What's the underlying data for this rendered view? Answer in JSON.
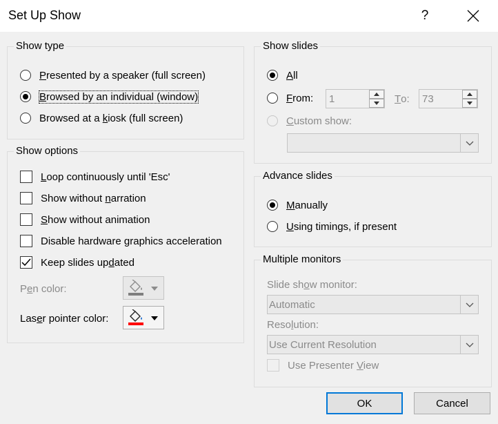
{
  "window": {
    "title": "Set Up Show",
    "help_label": "?"
  },
  "show_type": {
    "legend": "Show type",
    "options": [
      {
        "pre": "",
        "key": "P",
        "post": "resented by a speaker (full screen)",
        "checked": false
      },
      {
        "pre": "",
        "key": "B",
        "post": "rowsed by an individual (window)",
        "checked": true
      },
      {
        "pre": "Browsed at a ",
        "key": "k",
        "post": "iosk (full screen)",
        "checked": false
      }
    ]
  },
  "show_options": {
    "legend": "Show options",
    "items": [
      {
        "pre": "",
        "key": "L",
        "post": "oop continuously until 'Esc'",
        "checked": false
      },
      {
        "pre": "Show without ",
        "key": "n",
        "post": "arration",
        "checked": false
      },
      {
        "pre": "",
        "key": "S",
        "post": "how without animation",
        "checked": false
      },
      {
        "pre": "Disable hardware ",
        "key": "g",
        "post": "raphics acceleration",
        "checked": false
      },
      {
        "pre": "Keep slides up",
        "key": "d",
        "post": "ated",
        "checked": true
      }
    ],
    "pen_color": {
      "pre": "P",
      "key": "e",
      "post": "n color:"
    },
    "laser_color": {
      "pre": "Las",
      "key": "e",
      "post": "r pointer color:"
    },
    "pen_swatch": "#7f7f7f",
    "laser_swatch": "#ff0000"
  },
  "show_slides": {
    "legend": "Show slides",
    "all": {
      "key": "A",
      "post": "ll",
      "checked": true
    },
    "from": {
      "key": "F",
      "post": "rom:",
      "checked": false,
      "value": "1"
    },
    "to": {
      "key": "T",
      "post": "o:",
      "value": "73"
    },
    "custom": {
      "key": "C",
      "post": "ustom show:",
      "value": ""
    }
  },
  "advance_slides": {
    "legend": "Advance slides",
    "manually": {
      "key": "M",
      "post": "anually",
      "checked": true
    },
    "timings": {
      "key": "U",
      "post": "sing timings, if present",
      "checked": false
    }
  },
  "multiple_monitors": {
    "legend": "Multiple monitors",
    "monitor_label": {
      "pre": "Slide sh",
      "key": "o",
      "post": "w monitor:"
    },
    "monitor_value": "Automatic",
    "resolution_label": {
      "pre": "Reso",
      "key": "l",
      "post": "ution:"
    },
    "resolution_value": "Use Current Resolution",
    "presenter_view": {
      "pre": "Use Presenter ",
      "key": "V",
      "post": "iew",
      "checked": false
    }
  },
  "buttons": {
    "ok": "OK",
    "cancel": "Cancel"
  },
  "colors": {
    "accent": "#0078d7",
    "background": "#f0f0f0",
    "disabled": "#8a8a8a"
  }
}
